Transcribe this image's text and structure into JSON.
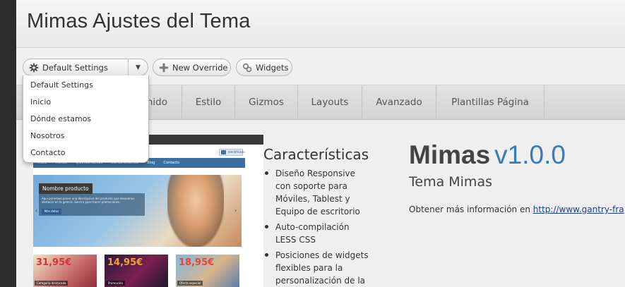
{
  "header": {
    "title": "Mimas Ajustes del Tema"
  },
  "toolbar": {
    "settings_label": "Default Settings",
    "override_label": "New Override",
    "widgets_label": "Widgets"
  },
  "dropdown": {
    "items": [
      "Default Settings",
      "Inicio",
      "Dónde estamos",
      "Nosotros",
      "Contacto"
    ]
  },
  "tabs": [
    "enido",
    "Estilo",
    "Gizmos",
    "Layouts",
    "Avanzado",
    "Plantillas Página"
  ],
  "preview": {
    "nav": [
      "Inicio",
      "Tienda",
      "Quienes somos",
      "Donde estamos",
      "Blog",
      "Contacto"
    ],
    "button": "Identificado",
    "slide_title": "Nombre producto",
    "slide_text": "Aqui ponemos poner una descripcion del producto que deseamos destacar en la galeria. Servira para hacer promociones.",
    "slide_button": "Más datos",
    "thumbs": [
      {
        "price": "31,95€",
        "caption": "Categoria destacada"
      },
      {
        "price": "14,95€",
        "caption": "Promoción"
      },
      {
        "price": "18,95€",
        "caption": "Oferta especial"
      }
    ]
  },
  "features": {
    "title": "Características",
    "items": [
      "Diseño Responsive con soporte para Móviles, Tablest y Equipo de escritorio",
      "Auto-compilación LESS CSS",
      "Posiciones de widgets flexibles para la personalización de la"
    ]
  },
  "brand": {
    "name": "Mimas",
    "version": "v1.0.0",
    "subtitle": "Tema Mimas",
    "info_text": "Obtener más información en ",
    "info_link": "http://www.gantry-fra"
  },
  "colors": {
    "accent": "#3c7ab4",
    "link": "#1a3f8c",
    "sidebar": "#2b2b2b"
  }
}
